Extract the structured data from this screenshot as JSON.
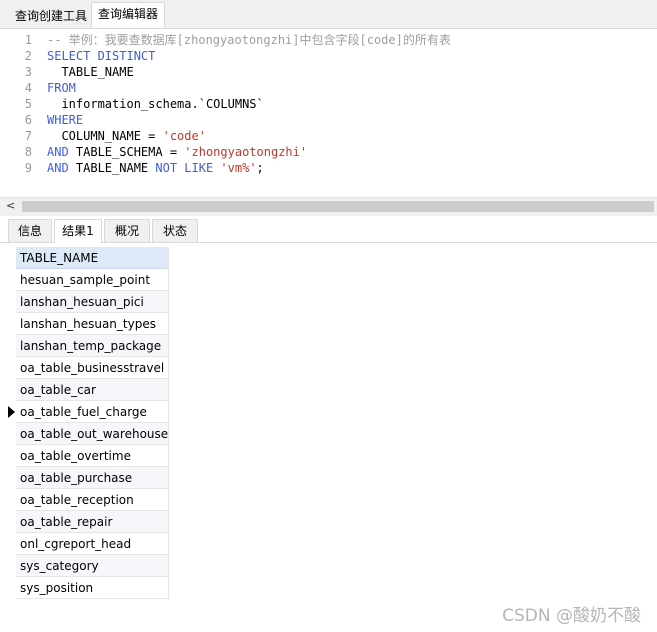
{
  "tabs": {
    "query_builder": "查询创建工具",
    "query_editor": "查询编辑器"
  },
  "editor": {
    "lines": [
      {
        "num": "1",
        "parts": [
          {
            "t": "-- 举例：我要查数据库[zhongyaotongzhi]中包含字段[code]的所有表",
            "c": "cm"
          }
        ]
      },
      {
        "num": "2",
        "parts": [
          {
            "t": "SELECT DISTINCT",
            "c": "kw"
          }
        ]
      },
      {
        "num": "3",
        "parts": [
          {
            "t": "  TABLE_NAME",
            "c": "id"
          }
        ]
      },
      {
        "num": "4",
        "parts": [
          {
            "t": "FROM",
            "c": "kw"
          }
        ]
      },
      {
        "num": "5",
        "parts": [
          {
            "t": "  information_schema.`COLUMNS`",
            "c": "id"
          }
        ]
      },
      {
        "num": "6",
        "parts": [
          {
            "t": "WHERE",
            "c": "kw"
          }
        ]
      },
      {
        "num": "7",
        "parts": [
          {
            "t": "  COLUMN_NAME = ",
            "c": "id"
          },
          {
            "t": "'code'",
            "c": "str"
          }
        ]
      },
      {
        "num": "8",
        "parts": [
          {
            "t": "AND",
            "c": "kw"
          },
          {
            "t": " TABLE_SCHEMA = ",
            "c": "id"
          },
          {
            "t": "'zhongyaotongzhi'",
            "c": "str"
          }
        ]
      },
      {
        "num": "9",
        "parts": [
          {
            "t": "AND",
            "c": "kw"
          },
          {
            "t": " TABLE_NAME ",
            "c": "id"
          },
          {
            "t": "NOT LIKE",
            "c": "kw"
          },
          {
            "t": " ",
            "c": "id"
          },
          {
            "t": "'vm%'",
            "c": "str"
          },
          {
            "t": ";",
            "c": "id"
          }
        ]
      }
    ]
  },
  "scrollbar": {
    "left_arrow": "<"
  },
  "result_tabs": [
    {
      "label": "信息",
      "active": false
    },
    {
      "label": "结果1",
      "active": true
    },
    {
      "label": "概况",
      "active": false
    },
    {
      "label": "状态",
      "active": false
    }
  ],
  "grid": {
    "column": "TABLE_NAME",
    "selected_row": 6,
    "rows": [
      "hesuan_sample_point",
      "lanshan_hesuan_pici",
      "lanshan_hesuan_types",
      "lanshan_temp_package",
      "oa_table_businesstravel",
      "oa_table_car",
      "oa_table_fuel_charge",
      "oa_table_out_warehouse",
      "oa_table_overtime",
      "oa_table_purchase",
      "oa_table_reception",
      "oa_table_repair",
      "onl_cgreport_head",
      "sys_category",
      "sys_position"
    ]
  },
  "watermark": "CSDN @酸奶不酸",
  "colors": {
    "keyword": "#3d5fd8",
    "string": "#c0392b",
    "comment": "#9e9e9e",
    "header_bg": "#dde9f7"
  }
}
